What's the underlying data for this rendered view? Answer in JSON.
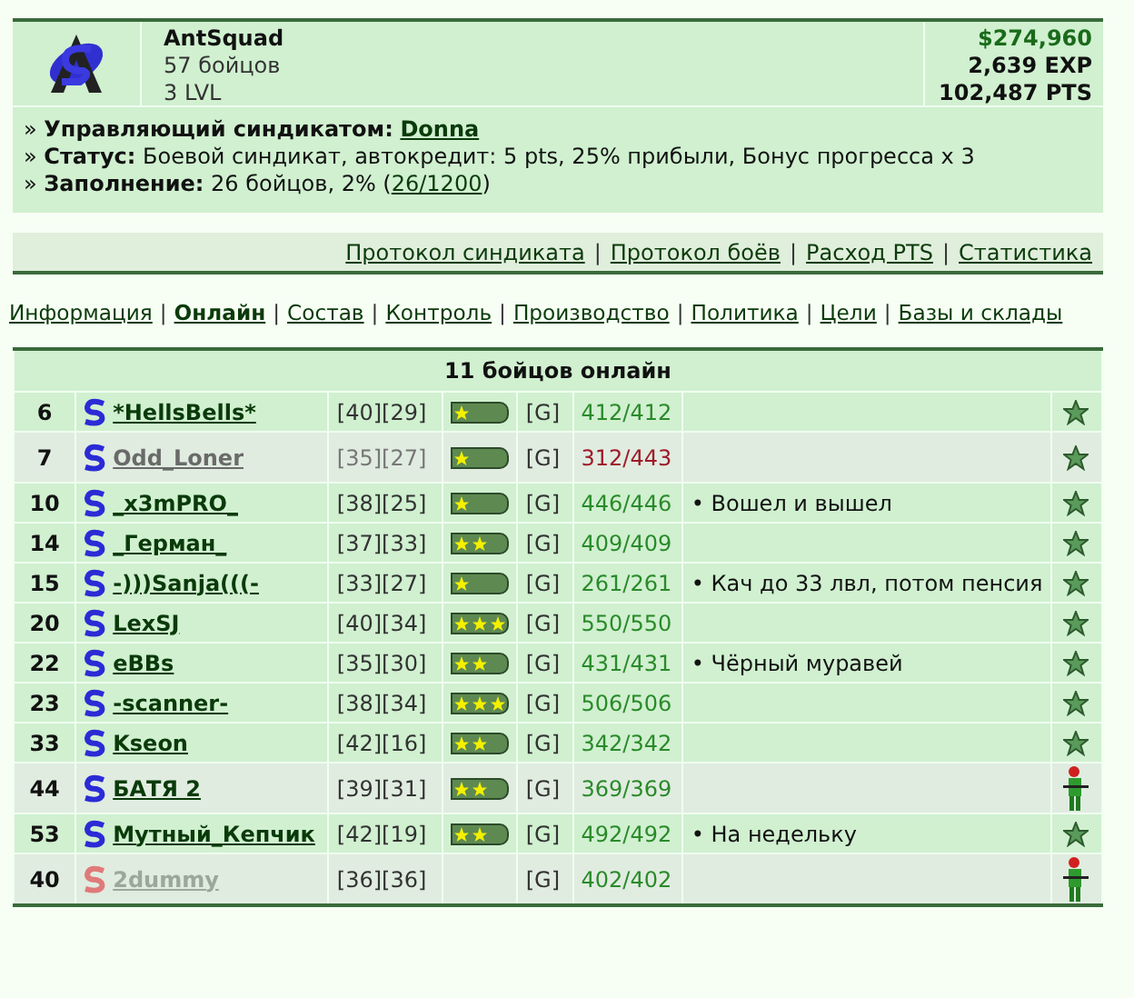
{
  "syndicate": {
    "name": "AntSquad",
    "members": "57 бойцов",
    "level": "3 LVL",
    "money": "$274,960",
    "exp": "2,639 EXP",
    "pts": "102,487 PTS"
  },
  "separator": "|",
  "info": [
    {
      "bullet": "»",
      "label": "Управляющий синдикатом:",
      "link": "Donna"
    },
    {
      "bullet": "»",
      "label": "Статус:",
      "text": " Боевой синдикат, автокредит: 5 pts, 25% прибыли, Бонус прогресса x 3"
    },
    {
      "bullet": "»",
      "label": "Заполнение:",
      "text": " 26 бойцов, 2% (",
      "link": "26/1200",
      "after": ")"
    }
  ],
  "links": [
    "Протокол синдиката",
    "Протокол боёв",
    "Расход PTS",
    "Статистика"
  ],
  "tabs": [
    {
      "label": "Информация",
      "selected": false
    },
    {
      "label": "Онлайн",
      "selected": true
    },
    {
      "label": "Состав",
      "selected": false
    },
    {
      "label": "Контроль",
      "selected": false
    },
    {
      "label": "Производство",
      "selected": false
    },
    {
      "label": "Политика",
      "selected": false
    },
    {
      "label": "Цели",
      "selected": false
    },
    {
      "label": "Базы и склады",
      "selected": false
    }
  ],
  "table": {
    "title": "11 бойцов онлайн",
    "rows": [
      {
        "num": "6",
        "name": "*HellsBells*",
        "idle": false,
        "offline": false,
        "highlighted": false,
        "levels": "[40][29]",
        "stars": 1,
        "group": "[G]",
        "hp": "412/412",
        "hp_low": false,
        "kind": "star"
      },
      {
        "num": "7",
        "name": "Odd_Loner",
        "idle": true,
        "offline": false,
        "highlighted": true,
        "levels": "[35][27]",
        "stars": 1,
        "group": "[G]",
        "hp": "312/443",
        "hp_low": true,
        "kind": "star"
      },
      {
        "num": "10",
        "name": "_x3mPRO_",
        "idle": false,
        "offline": false,
        "highlighted": false,
        "levels": "[38][25]",
        "stars": 1,
        "group": "[G]",
        "hp": "446/446",
        "hp_low": false,
        "note": "• Вошел и вышел",
        "kind": "star"
      },
      {
        "num": "14",
        "name": "_Герман_",
        "idle": false,
        "offline": false,
        "highlighted": false,
        "levels": "[37][33]",
        "stars": 2,
        "group": "[G]",
        "hp": "409/409",
        "hp_low": false,
        "kind": "star"
      },
      {
        "num": "15",
        "name": "-)))Sanja(((-",
        "idle": false,
        "offline": false,
        "highlighted": false,
        "levels": "[33][27]",
        "stars": 1,
        "group": "[G]",
        "hp": "261/261",
        "hp_low": false,
        "note": "• Кач до 33 лвл, потом пенсия",
        "kind": "star"
      },
      {
        "num": "20",
        "name": "LexSJ",
        "idle": false,
        "offline": false,
        "highlighted": false,
        "levels": "[40][34]",
        "stars": 3,
        "group": "[G]",
        "hp": "550/550",
        "hp_low": false,
        "kind": "star"
      },
      {
        "num": "22",
        "name": "eBBs",
        "idle": false,
        "offline": false,
        "highlighted": false,
        "levels": "[35][30]",
        "stars": 2,
        "group": "[G]",
        "hp": "431/431",
        "hp_low": false,
        "note": "• Чёрный муравей",
        "kind": "star"
      },
      {
        "num": "23",
        "name": "-scanner-",
        "idle": false,
        "offline": false,
        "highlighted": false,
        "levels": "[38][34]",
        "stars": 3,
        "group": "[G]",
        "hp": "506/506",
        "hp_low": false,
        "kind": "star"
      },
      {
        "num": "33",
        "name": "Kseon",
        "idle": false,
        "offline": false,
        "highlighted": false,
        "levels": "[42][16]",
        "stars": 2,
        "group": "[G]",
        "hp": "342/342",
        "hp_low": false,
        "kind": "star"
      },
      {
        "num": "44",
        "name": "БАТЯ 2",
        "idle": false,
        "offline": false,
        "highlighted": true,
        "levels": "[39][31]",
        "stars": 2,
        "group": "[G]",
        "hp": "369/369",
        "hp_low": false,
        "kind": "soldier"
      },
      {
        "num": "53",
        "name": "Мутный_Кепчик",
        "idle": false,
        "offline": false,
        "highlighted": false,
        "levels": "[42][19]",
        "stars": 2,
        "group": "[G]",
        "hp": "492/492",
        "hp_low": false,
        "note": "• На недельку",
        "kind": "star"
      },
      {
        "num": "40",
        "name": "2dummy",
        "idle": false,
        "offline": true,
        "highlighted": true,
        "levels": "[36][36]",
        "group": "[G]",
        "hp": "402/402",
        "hp_low": false,
        "kind": "soldier"
      }
    ]
  }
}
